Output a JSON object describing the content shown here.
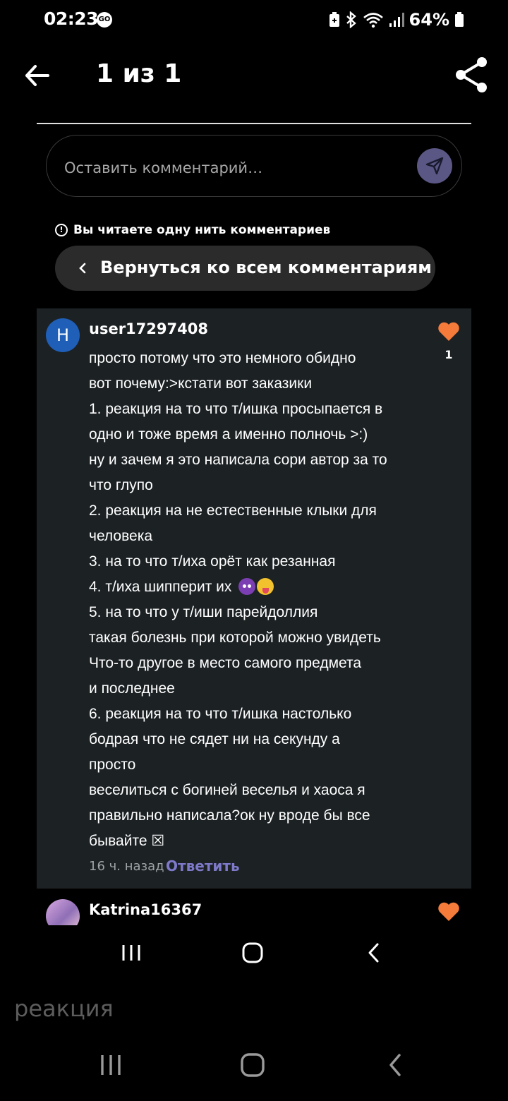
{
  "status_bar": {
    "time": "02:23",
    "go_badge": "GO",
    "battery": "64%"
  },
  "header": {
    "title": "1 из 1",
    "back_icon": "arrow-left-icon",
    "share_icon": "share-icon"
  },
  "comment_input": {
    "placeholder": "Оставить комментарий…",
    "send_icon": "send-icon",
    "send_color": "#5a5785"
  },
  "thread_notice": {
    "text": "Вы читаете одну нить комментариев"
  },
  "return_button": {
    "label": "Вернуться ко всем комментариям"
  },
  "comment": {
    "avatar_letter": "H",
    "avatar_color": "#1f5fb8",
    "author": "user17297408",
    "likes": "1",
    "like_color": "#f47b3a",
    "lines": [
      "просто потому что это немного обидно",
      "вот почему:>кстати вот заказики",
      "1. реакция на то что т/ишка просыпается в",
      "одно и тоже время а именно полночь >:)",
      "ну и зачем я это написала сори автор за то",
      "что глупо",
      "2. реакция на не естественные клыки для",
      "человека",
      "3. на то что т/иха орёт как резанная",
      "4. т/иха шипперит их",
      "5. на то что у т/иши парейдоллия",
      "такая болезнь при которой можно увидеть",
      "Что-то другое в место самого предмета",
      "и последнее",
      "6. реакция на то что т/ишка настолько",
      "бодрая что не сядет ни на секунду а",
      "просто",
      "веселиться с богиней веселья и хаоса я",
      "правильно написала?ок ну вроде бы все",
      "бывайте ☒"
    ],
    "time_ago": "16 ч. назад",
    "reply_label": "Ответить"
  },
  "comment2": {
    "author": "Katrina16367"
  },
  "caption": "реакция"
}
